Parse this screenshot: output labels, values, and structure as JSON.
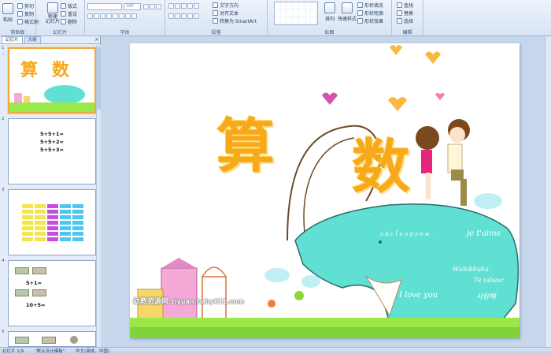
{
  "ribbon": {
    "clipboard": {
      "label": "剪贴板",
      "paste": "粘贴",
      "cut": "剪切",
      "copy": "复制",
      "format_painter": "格式刷"
    },
    "slides": {
      "label": "幻灯片",
      "new_slide": "新建\n幻灯片",
      "layout": "版式",
      "reset": "重设",
      "delete": "删除"
    },
    "font": {
      "label": "字体",
      "size_value": "166"
    },
    "paragraph": {
      "label": "段落",
      "text_direction": "文字方向",
      "align_text": "对齐文本",
      "smartart": "转换为 SmartArt"
    },
    "drawing": {
      "label": "绘图",
      "arrange": "排列",
      "quick_styles": "快速样式",
      "shape_fill": "形状填充",
      "shape_outline": "形状轮廓",
      "shape_effects": "形状效果"
    },
    "editing": {
      "label": "编辑",
      "find": "查找",
      "replace": "替换",
      "select": "选择"
    }
  },
  "panel": {
    "tab_slides": "幻灯片",
    "tab_outline": "大纲",
    "close": "×",
    "slides": [
      {
        "num": "1"
      },
      {
        "num": "2",
        "lines": [
          "5+5+1=",
          "5+5+2=",
          "5+5+3="
        ]
      },
      {
        "num": "3"
      },
      {
        "num": "4",
        "lines": [
          "5+1=",
          "10+5="
        ]
      },
      {
        "num": "5"
      }
    ],
    "thumb1_title": "算 数"
  },
  "slide": {
    "char1": "算",
    "char2": "数",
    "text_abc": "a b c Ï n o p s n w .",
    "text_jet": "je t'aime",
    "text_wuhi": "Wuhibbuka.",
    "text_te": "Te iubesc",
    "text_korean": "사랑해",
    "text_love": "I love you",
    "watermark1": "幼教资源网",
    "watermark2": "ziyuan.baby611.com"
  },
  "status": {
    "slide_info": "幻灯片 1/9",
    "theme": "\"默认设计模板\"",
    "language": "中文(简体，中国)"
  },
  "colors": {
    "accent_orange": "#f7a81b",
    "elephant": "#5fe0d2",
    "grass": "#9be84b",
    "pink_house": "#f5a9d7"
  }
}
